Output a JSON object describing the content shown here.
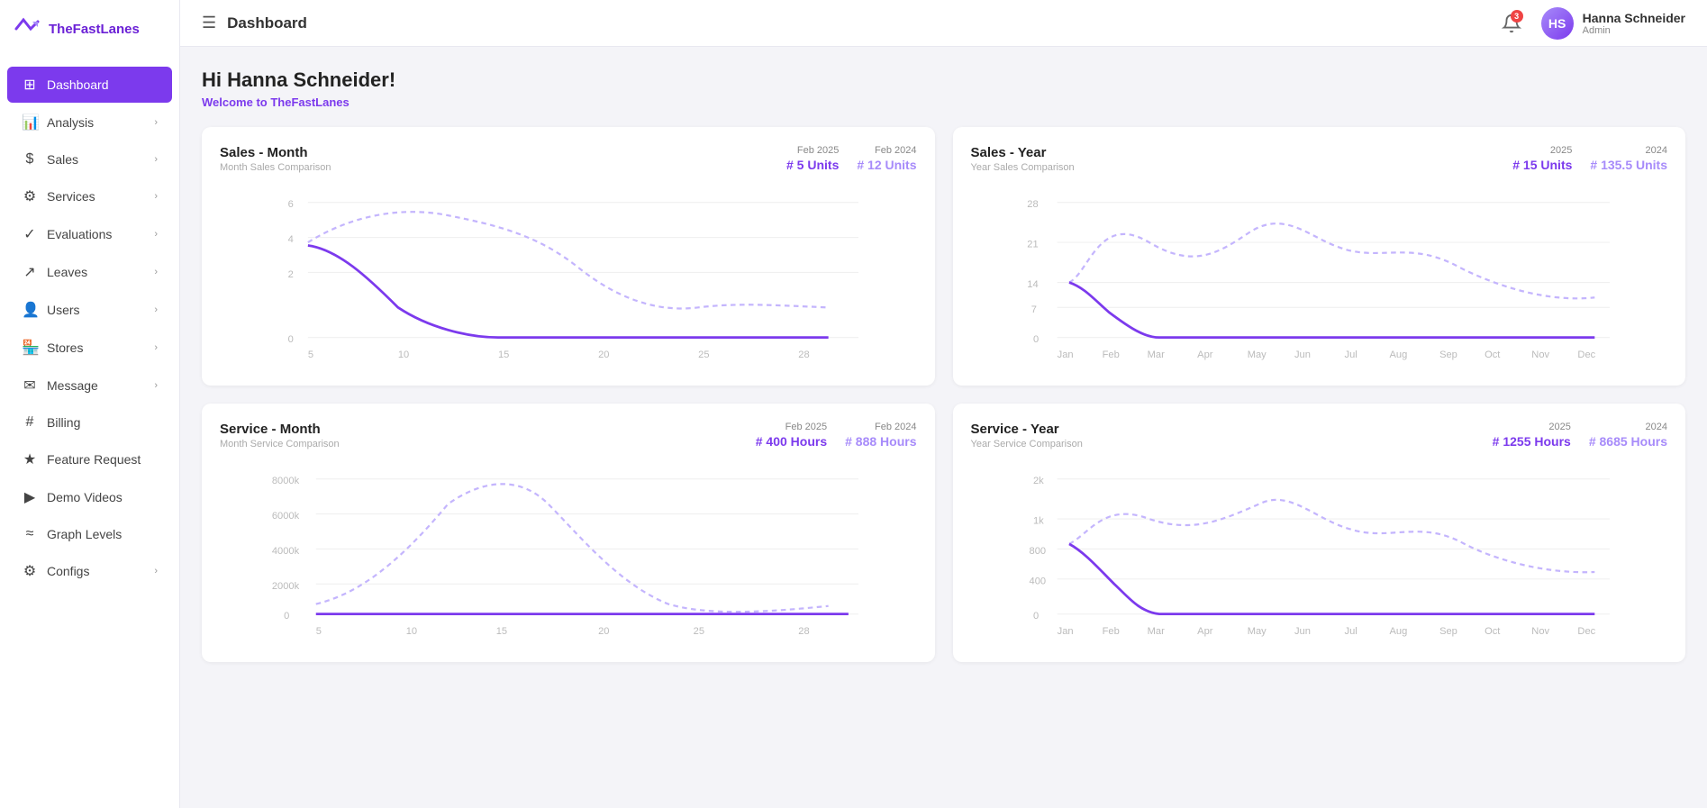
{
  "app": {
    "name": "TheFastLanes"
  },
  "topbar": {
    "title": "Dashboard"
  },
  "user": {
    "name": "Hanna Schneider",
    "role": "Admin",
    "initials": "HS",
    "notifications": "3"
  },
  "greeting": {
    "title": "Hi Hanna Schneider!",
    "subtitle": "Welcome to",
    "brand": "TheFastLanes"
  },
  "sidebar": {
    "items": [
      {
        "id": "dashboard",
        "label": "Dashboard",
        "icon": "⊞",
        "active": true,
        "hasChevron": false
      },
      {
        "id": "analysis",
        "label": "Analysis",
        "icon": "📊",
        "active": false,
        "hasChevron": true
      },
      {
        "id": "sales",
        "label": "Sales",
        "icon": "$",
        "active": false,
        "hasChevron": true
      },
      {
        "id": "services",
        "label": "Services",
        "icon": "⚙",
        "active": false,
        "hasChevron": true
      },
      {
        "id": "evaluations",
        "label": "Evaluations",
        "icon": "✓",
        "active": false,
        "hasChevron": true
      },
      {
        "id": "leaves",
        "label": "Leaves",
        "icon": "↗",
        "active": false,
        "hasChevron": true
      },
      {
        "id": "users",
        "label": "Users",
        "icon": "👤",
        "active": false,
        "hasChevron": true
      },
      {
        "id": "stores",
        "label": "Stores",
        "icon": "🏪",
        "active": false,
        "hasChevron": true
      },
      {
        "id": "message",
        "label": "Message",
        "icon": "✉",
        "active": false,
        "hasChevron": true
      },
      {
        "id": "billing",
        "label": "Billing",
        "icon": "#",
        "active": false,
        "hasChevron": false
      },
      {
        "id": "feature-request",
        "label": "Feature Request",
        "icon": "★",
        "active": false,
        "hasChevron": false
      },
      {
        "id": "demo-videos",
        "label": "Demo Videos",
        "icon": "▶",
        "active": false,
        "hasChevron": false
      },
      {
        "id": "graph-levels",
        "label": "Graph Levels",
        "icon": "≈",
        "active": false,
        "hasChevron": false
      },
      {
        "id": "configs",
        "label": "Configs",
        "icon": "⚙",
        "active": false,
        "hasChevron": true
      }
    ]
  },
  "charts": {
    "sales_month": {
      "title": "Sales - Month",
      "subtitle": "Month Sales Comparison",
      "legend": {
        "year1": "Feb 2025",
        "year2": "Feb 2024",
        "value1": "# 5 Units",
        "value2": "# 12 Units"
      }
    },
    "sales_year": {
      "title": "Sales - Year",
      "subtitle": "Year Sales Comparison",
      "legend": {
        "year1": "2025",
        "year2": "2024",
        "value1": "# 15 Units",
        "value2": "# 135.5 Units"
      }
    },
    "service_month": {
      "title": "Service - Month",
      "subtitle": "Month Service Comparison",
      "legend": {
        "year1": "Feb 2025",
        "year2": "Feb 2024",
        "value1": "# 400 Hours",
        "value2": "# 888 Hours"
      }
    },
    "service_year": {
      "title": "Service - Year",
      "subtitle": "Year Service Comparison",
      "legend": {
        "year1": "2025",
        "year2": "2024",
        "value1": "# 1255 Hours",
        "value2": "# 8685 Hours"
      }
    }
  }
}
